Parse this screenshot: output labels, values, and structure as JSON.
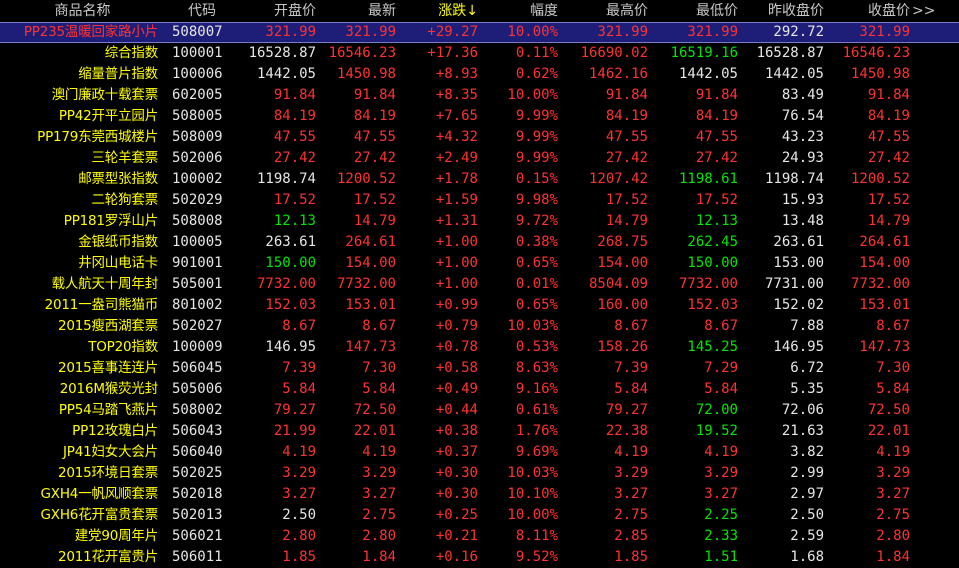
{
  "colors": {
    "up": "#ff3232",
    "down": "#00e600",
    "flat": "#e6e6e6",
    "name": "#ffff00",
    "header": "#c8c8c8",
    "sort": "#ffff00",
    "selected_bg": "#1e1e78"
  },
  "header": {
    "name": "商品名称",
    "code": "代码",
    "open": "开盘价",
    "last": "最新",
    "change": "涨跌↓",
    "amplitude": "幅度",
    "high": "最高价",
    "low": "最低价",
    "prev_close": "昨收盘价",
    "close": "收盘价",
    "more": ">>"
  },
  "rows": [
    {
      "name": "PP235温暖回家路小片",
      "code": "508007",
      "open": "321.99",
      "last": "321.99",
      "change": "+29.27",
      "amp": "10.00%",
      "high": "321.99",
      "low": "321.99",
      "prev": "292.72",
      "close": "321.99",
      "c": [
        "r",
        "r",
        "r",
        "r",
        "r",
        "r",
        "w",
        "r"
      ]
    },
    {
      "name": "综合指数",
      "code": "100001",
      "open": "16528.87",
      "last": "16546.23",
      "change": "+17.36",
      "amp": "0.11%",
      "high": "16690.02",
      "low": "16519.16",
      "prev": "16528.87",
      "close": "16546.23",
      "c": [
        "w",
        "r",
        "r",
        "r",
        "r",
        "g",
        "w",
        "r"
      ]
    },
    {
      "name": "缩量普片指数",
      "code": "100006",
      "open": "1442.05",
      "last": "1450.98",
      "change": "+8.93",
      "amp": "0.62%",
      "high": "1462.16",
      "low": "1442.05",
      "prev": "1442.05",
      "close": "1450.98",
      "c": [
        "w",
        "r",
        "r",
        "r",
        "r",
        "w",
        "w",
        "r"
      ]
    },
    {
      "name": "澳门廉政十载套票",
      "code": "602005",
      "open": "91.84",
      "last": "91.84",
      "change": "+8.35",
      "amp": "10.00%",
      "high": "91.84",
      "low": "91.84",
      "prev": "83.49",
      "close": "91.84",
      "c": [
        "r",
        "r",
        "r",
        "r",
        "r",
        "r",
        "w",
        "r"
      ]
    },
    {
      "name": "PP42开平立园片",
      "code": "508005",
      "open": "84.19",
      "last": "84.19",
      "change": "+7.65",
      "amp": "9.99%",
      "high": "84.19",
      "low": "84.19",
      "prev": "76.54",
      "close": "84.19",
      "c": [
        "r",
        "r",
        "r",
        "r",
        "r",
        "r",
        "w",
        "r"
      ]
    },
    {
      "name": "PP179东莞西城楼片",
      "code": "508009",
      "open": "47.55",
      "last": "47.55",
      "change": "+4.32",
      "amp": "9.99%",
      "high": "47.55",
      "low": "47.55",
      "prev": "43.23",
      "close": "47.55",
      "c": [
        "r",
        "r",
        "r",
        "r",
        "r",
        "r",
        "w",
        "r"
      ]
    },
    {
      "name": "三轮羊套票",
      "code": "502006",
      "open": "27.42",
      "last": "27.42",
      "change": "+2.49",
      "amp": "9.99%",
      "high": "27.42",
      "low": "27.42",
      "prev": "24.93",
      "close": "27.42",
      "c": [
        "r",
        "r",
        "r",
        "r",
        "r",
        "r",
        "w",
        "r"
      ]
    },
    {
      "name": "邮票型张指数",
      "code": "100002",
      "open": "1198.74",
      "last": "1200.52",
      "change": "+1.78",
      "amp": "0.15%",
      "high": "1207.42",
      "low": "1198.61",
      "prev": "1198.74",
      "close": "1200.52",
      "c": [
        "w",
        "r",
        "r",
        "r",
        "r",
        "g",
        "w",
        "r"
      ]
    },
    {
      "name": "二轮狗套票",
      "code": "502029",
      "open": "17.52",
      "last": "17.52",
      "change": "+1.59",
      "amp": "9.98%",
      "high": "17.52",
      "low": "17.52",
      "prev": "15.93",
      "close": "17.52",
      "c": [
        "r",
        "r",
        "r",
        "r",
        "r",
        "r",
        "w",
        "r"
      ]
    },
    {
      "name": "PP181罗浮山片",
      "code": "508008",
      "open": "12.13",
      "last": "14.79",
      "change": "+1.31",
      "amp": "9.72%",
      "high": "14.79",
      "low": "12.13",
      "prev": "13.48",
      "close": "14.79",
      "c": [
        "g",
        "r",
        "r",
        "r",
        "r",
        "g",
        "w",
        "r"
      ]
    },
    {
      "name": "金银纸币指数",
      "code": "100005",
      "open": "263.61",
      "last": "264.61",
      "change": "+1.00",
      "amp": "0.38%",
      "high": "268.75",
      "low": "262.45",
      "prev": "263.61",
      "close": "264.61",
      "c": [
        "w",
        "r",
        "r",
        "r",
        "r",
        "g",
        "w",
        "r"
      ]
    },
    {
      "name": "井冈山电话卡",
      "code": "901001",
      "open": "150.00",
      "last": "154.00",
      "change": "+1.00",
      "amp": "0.65%",
      "high": "154.00",
      "low": "150.00",
      "prev": "153.00",
      "close": "154.00",
      "c": [
        "g",
        "r",
        "r",
        "r",
        "r",
        "g",
        "w",
        "r"
      ]
    },
    {
      "name": "载人航天十周年封",
      "code": "505001",
      "open": "7732.00",
      "last": "7732.00",
      "change": "+1.00",
      "amp": "0.01%",
      "high": "8504.09",
      "low": "7732.00",
      "prev": "7731.00",
      "close": "7732.00",
      "c": [
        "r",
        "r",
        "r",
        "r",
        "r",
        "r",
        "w",
        "r"
      ]
    },
    {
      "name": "2011一盎司熊猫币",
      "code": "801002",
      "open": "152.03",
      "last": "153.01",
      "change": "+0.99",
      "amp": "0.65%",
      "high": "160.00",
      "low": "152.03",
      "prev": "152.02",
      "close": "153.01",
      "c": [
        "r",
        "r",
        "r",
        "r",
        "r",
        "r",
        "w",
        "r"
      ]
    },
    {
      "name": "2015瘦西湖套票",
      "code": "502027",
      "open": "8.67",
      "last": "8.67",
      "change": "+0.79",
      "amp": "10.03%",
      "high": "8.67",
      "low": "8.67",
      "prev": "7.88",
      "close": "8.67",
      "c": [
        "r",
        "r",
        "r",
        "r",
        "r",
        "r",
        "w",
        "r"
      ]
    },
    {
      "name": "TOP20指数",
      "code": "100009",
      "open": "146.95",
      "last": "147.73",
      "change": "+0.78",
      "amp": "0.53%",
      "high": "158.26",
      "low": "145.25",
      "prev": "146.95",
      "close": "147.73",
      "c": [
        "w",
        "r",
        "r",
        "r",
        "r",
        "g",
        "w",
        "r"
      ]
    },
    {
      "name": "2015喜事连连片",
      "code": "506045",
      "open": "7.39",
      "last": "7.30",
      "change": "+0.58",
      "amp": "8.63%",
      "high": "7.39",
      "low": "7.29",
      "prev": "6.72",
      "close": "7.30",
      "c": [
        "r",
        "r",
        "r",
        "r",
        "r",
        "r",
        "w",
        "r"
      ]
    },
    {
      "name": "2016M猴荧光封",
      "code": "505006",
      "open": "5.84",
      "last": "5.84",
      "change": "+0.49",
      "amp": "9.16%",
      "high": "5.84",
      "low": "5.84",
      "prev": "5.35",
      "close": "5.84",
      "c": [
        "r",
        "r",
        "r",
        "r",
        "r",
        "r",
        "w",
        "r"
      ]
    },
    {
      "name": "PP54马踏飞燕片",
      "code": "508002",
      "open": "79.27",
      "last": "72.50",
      "change": "+0.44",
      "amp": "0.61%",
      "high": "79.27",
      "low": "72.00",
      "prev": "72.06",
      "close": "72.50",
      "c": [
        "r",
        "r",
        "r",
        "r",
        "r",
        "g",
        "w",
        "r"
      ]
    },
    {
      "name": "PP12玫瑰白片",
      "code": "506043",
      "open": "21.99",
      "last": "22.01",
      "change": "+0.38",
      "amp": "1.76%",
      "high": "22.38",
      "low": "19.52",
      "prev": "21.63",
      "close": "22.01",
      "c": [
        "r",
        "r",
        "r",
        "r",
        "r",
        "g",
        "w",
        "r"
      ]
    },
    {
      "name": "JP41妇女大会片",
      "code": "506040",
      "open": "4.19",
      "last": "4.19",
      "change": "+0.37",
      "amp": "9.69%",
      "high": "4.19",
      "low": "4.19",
      "prev": "3.82",
      "close": "4.19",
      "c": [
        "r",
        "r",
        "r",
        "r",
        "r",
        "r",
        "w",
        "r"
      ]
    },
    {
      "name": "2015环境日套票",
      "code": "502025",
      "open": "3.29",
      "last": "3.29",
      "change": "+0.30",
      "amp": "10.03%",
      "high": "3.29",
      "low": "3.29",
      "prev": "2.99",
      "close": "3.29",
      "c": [
        "r",
        "r",
        "r",
        "r",
        "r",
        "r",
        "w",
        "r"
      ]
    },
    {
      "name": "GXH4一帆风顺套票",
      "code": "502018",
      "open": "3.27",
      "last": "3.27",
      "change": "+0.30",
      "amp": "10.10%",
      "high": "3.27",
      "low": "3.27",
      "prev": "2.97",
      "close": "3.27",
      "c": [
        "r",
        "r",
        "r",
        "r",
        "r",
        "r",
        "w",
        "r"
      ]
    },
    {
      "name": "GXH6花开富贵套票",
      "code": "502013",
      "open": "2.50",
      "last": "2.75",
      "change": "+0.25",
      "amp": "10.00%",
      "high": "2.75",
      "low": "2.25",
      "prev": "2.50",
      "close": "2.75",
      "c": [
        "w",
        "r",
        "r",
        "r",
        "r",
        "g",
        "w",
        "r"
      ]
    },
    {
      "name": "建党90周年片",
      "code": "506021",
      "open": "2.80",
      "last": "2.80",
      "change": "+0.21",
      "amp": "8.11%",
      "high": "2.85",
      "low": "2.33",
      "prev": "2.59",
      "close": "2.80",
      "c": [
        "r",
        "r",
        "r",
        "r",
        "r",
        "g",
        "w",
        "r"
      ]
    },
    {
      "name": "2011花开富贵片",
      "code": "506011",
      "open": "1.85",
      "last": "1.84",
      "change": "+0.16",
      "amp": "9.52%",
      "high": "1.85",
      "low": "1.51",
      "prev": "1.68",
      "close": "1.84",
      "c": [
        "r",
        "r",
        "r",
        "r",
        "r",
        "g",
        "w",
        "r"
      ]
    }
  ]
}
